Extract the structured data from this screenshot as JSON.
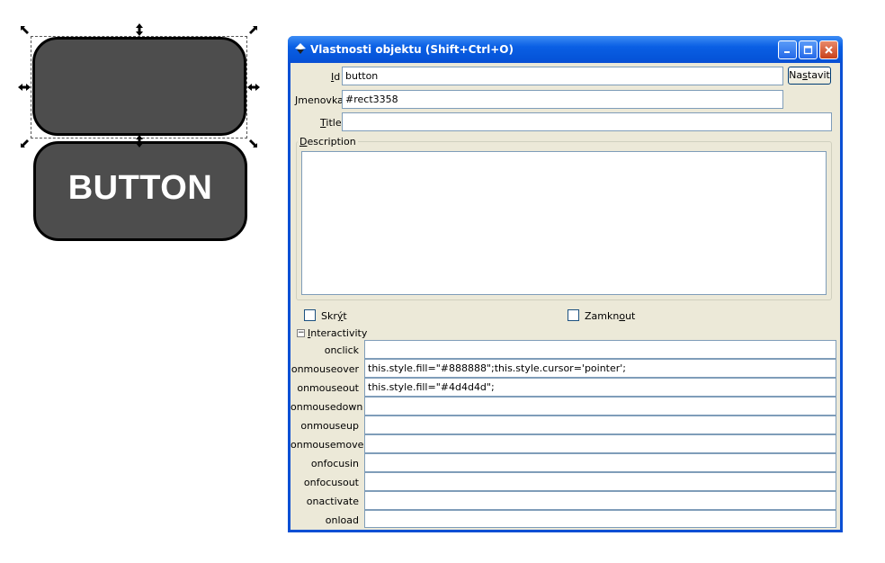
{
  "canvas": {
    "button_text": "BUTTON"
  },
  "dialog": {
    "title": "Vlastnosti objektu (Shift+Ctrl+O)",
    "id_label_pre": "",
    "id_label_u": "I",
    "id_label_post": "d",
    "id_value": "button",
    "set_button_pre": "Na",
    "set_button_u": "s",
    "set_button_post": "tavit",
    "label_label": "Jmenovka",
    "label_value": "#rect3358",
    "title_label_u": "T",
    "title_label_post": "itle",
    "title_value": "",
    "description_label_u": "D",
    "description_label_post": "escription",
    "hide_label_pre": "Skr",
    "hide_label_u": "ý",
    "hide_label_post": "t",
    "lock_label_pre": "Zamkn",
    "lock_label_u": "o",
    "lock_label_post": "ut",
    "interactivity_label_u": "I",
    "interactivity_label_post": "nteractivity",
    "events": [
      {
        "label": "onclick",
        "value": ""
      },
      {
        "label": "onmouseover",
        "value": "this.style.fill=\"#888888\";this.style.cursor='pointer';"
      },
      {
        "label": "onmouseout",
        "value": "this.style.fill=\"#4d4d4d\";"
      },
      {
        "label": "onmousedown",
        "value": ""
      },
      {
        "label": "onmouseup",
        "value": ""
      },
      {
        "label": "onmousemove",
        "value": ""
      },
      {
        "label": "onfocusin",
        "value": ""
      },
      {
        "label": "onfocusout",
        "value": ""
      },
      {
        "label": "onactivate",
        "value": ""
      },
      {
        "label": "onload",
        "value": ""
      }
    ]
  },
  "colors": {
    "shape_fill": "#4d4d4d",
    "titlebar_blue": "#0a5fe4",
    "dialog_bg": "#ece9d8"
  },
  "icons": [
    "inkscape-logo-icon",
    "minimize-icon",
    "maximize-icon",
    "close-icon",
    "resize-arrow-icon",
    "collapse-icon"
  ]
}
